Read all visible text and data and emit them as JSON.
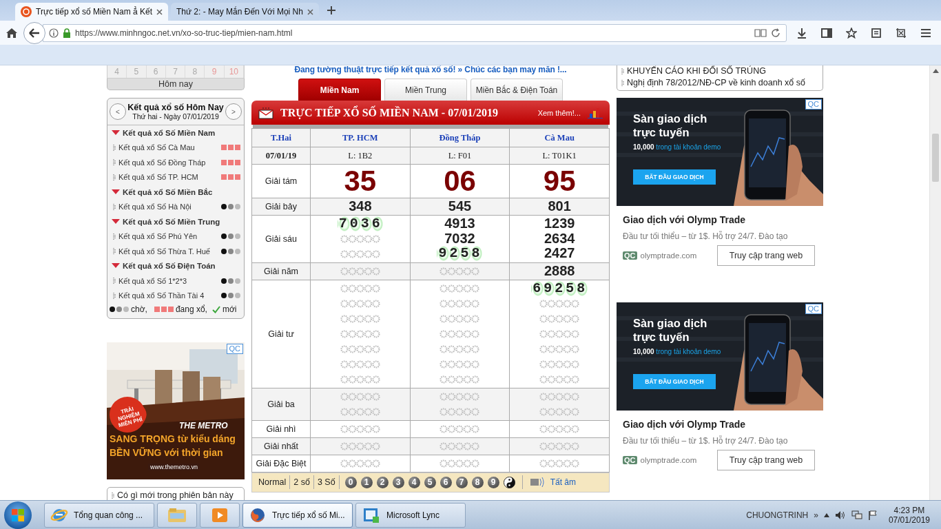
{
  "browser": {
    "tabs": [
      {
        "title": "Trực tiếp xổ số Miền Nam ẳ Kết",
        "selected": true
      },
      {
        "title": "Thứ 2: - May Mắn Đến Với Mọi Nh",
        "selected": false
      }
    ],
    "url": "https://www.minhngoc.net.vn/xo-so-truc-tiep/mien-nam.html"
  },
  "left": {
    "calendar": [
      {
        "day": "4",
        "weekend": false
      },
      {
        "day": "5",
        "weekend": false
      },
      {
        "day": "6",
        "weekend": false
      },
      {
        "day": "7",
        "weekend": false
      },
      {
        "day": "8",
        "weekend": false
      },
      {
        "day": "9",
        "weekend": true
      },
      {
        "day": "10",
        "weekend": true
      }
    ],
    "today_button": "Hôm nay",
    "results_panel": {
      "prev": "<",
      "next": ">",
      "title": "Kết quả xổ số Hôm Nay",
      "subtitle": "Thứ hai - Ngày 07/01/2019",
      "groups": [
        {
          "label": "Kết quả xổ Số Miền Nam",
          "expanded": true,
          "children": [
            {
              "label": "Kết quả xổ Số Cà Mau",
              "drawing": true
            },
            {
              "label": "Kết quả xổ Số Đồng Tháp",
              "drawing": true
            },
            {
              "label": "Kết quả xổ Số TP. HCM",
              "drawing": true
            }
          ]
        },
        {
          "label": "Kết quả xổ Số Miền Bắc",
          "expanded": true,
          "children": [
            {
              "label": "Kết quả xổ Số Hà Nội",
              "drawing": false
            }
          ]
        },
        {
          "label": "Kết quả xổ Số Miền Trung",
          "expanded": true,
          "children": [
            {
              "label": "Kết quả xổ Số Phú Yên",
              "drawing": false
            },
            {
              "label": "Kết quả xổ Số Thừa T. Huế",
              "drawing": false
            }
          ]
        },
        {
          "label": "Kết quả xổ Số Điện Toán",
          "expanded": true,
          "children": [
            {
              "label": "Kết quả xổ Số 1*2*3",
              "drawing": false
            },
            {
              "label": "Kết quả xổ Số Thần Tài 4",
              "drawing": false
            }
          ]
        }
      ],
      "legend": {
        "waiting": "chờ,",
        "drawing": "đang xổ,",
        "new": "mới"
      }
    },
    "ad": {
      "badge": "QC",
      "ribbon": "TRẢI NGHIỆM MIỄN PHÍ",
      "brand": "THE METRO",
      "line_1": "SANG TRỌNG từ kiểu dáng",
      "line_2": "BỀN VỮNG với thời gian",
      "site": "www.themetro.vn"
    },
    "news": [
      "Có gì mới trong phiên bản này"
    ]
  },
  "center": {
    "headline": "Đang tường thuật trực tiếp kết quả xổ số! » Chúc các bạn may mắn !...",
    "tabs": [
      {
        "label": "Miền Nam",
        "selected": true
      },
      {
        "label": "Miền Trung",
        "selected": false
      },
      {
        "label": "Miền Bắc & Điện Toán",
        "selected": false
      }
    ],
    "banner": {
      "title": "TRỰC TIẾP XỔ SỐ MIỀN NAM - 07/01/2019",
      "more": "Xem thêm!..."
    },
    "table": {
      "columns": [
        "T.Hai",
        "TP. HCM",
        "Đồng Tháp",
        "Cà Mau"
      ],
      "date_row": [
        "07/01/19",
        "L: 1B2",
        "L: F01",
        "L: T01K1"
      ],
      "prizes": [
        {
          "label": "Giải tám",
          "cells": [
            [
              {
                "kind": "number",
                "value": "35"
              }
            ],
            [
              {
                "kind": "number",
                "value": "06"
              }
            ],
            [
              {
                "kind": "number",
                "value": "95"
              }
            ]
          ]
        },
        {
          "label": "Giải bảy",
          "cells": [
            [
              {
                "kind": "number",
                "value": "348"
              }
            ],
            [
              {
                "kind": "number",
                "value": "545"
              }
            ],
            [
              {
                "kind": "number",
                "value": "801"
              }
            ]
          ]
        },
        {
          "label": "Giải sáu",
          "cells": [
            [
              {
                "kind": "new",
                "value": "7036"
              },
              {
                "kind": "pending"
              },
              {
                "kind": "pending"
              }
            ],
            [
              {
                "kind": "number",
                "value": "4913"
              },
              {
                "kind": "number",
                "value": "7032"
              },
              {
                "kind": "new",
                "value": "9258"
              }
            ],
            [
              {
                "kind": "number",
                "value": "1239"
              },
              {
                "kind": "number",
                "value": "2634"
              },
              {
                "kind": "number",
                "value": "2427"
              }
            ]
          ]
        },
        {
          "label": "Giải năm",
          "cells": [
            [
              {
                "kind": "pending"
              }
            ],
            [
              {
                "kind": "pending"
              }
            ],
            [
              {
                "kind": "number",
                "value": "2888"
              }
            ]
          ]
        },
        {
          "label": "Giải tư",
          "cells": [
            [
              {
                "kind": "pending"
              },
              {
                "kind": "pending"
              },
              {
                "kind": "pending"
              },
              {
                "kind": "pending"
              },
              {
                "kind": "pending"
              },
              {
                "kind": "pending"
              },
              {
                "kind": "pending"
              }
            ],
            [
              {
                "kind": "pending"
              },
              {
                "kind": "pending"
              },
              {
                "kind": "pending"
              },
              {
                "kind": "pending"
              },
              {
                "kind": "pending"
              },
              {
                "kind": "pending"
              },
              {
                "kind": "pending"
              }
            ],
            [
              {
                "kind": "new",
                "value": "69258"
              },
              {
                "kind": "pending"
              },
              {
                "kind": "pending"
              },
              {
                "kind": "pending"
              },
              {
                "kind": "pending"
              },
              {
                "kind": "pending"
              },
              {
                "kind": "pending"
              }
            ]
          ]
        },
        {
          "label": "Giải ba",
          "cells": [
            [
              {
                "kind": "pending"
              },
              {
                "kind": "pending"
              }
            ],
            [
              {
                "kind": "pending"
              },
              {
                "kind": "pending"
              }
            ],
            [
              {
                "kind": "pending"
              },
              {
                "kind": "pending"
              }
            ]
          ]
        },
        {
          "label": "Giải nhì",
          "cells": [
            [
              {
                "kind": "pending"
              }
            ],
            [
              {
                "kind": "pending"
              }
            ],
            [
              {
                "kind": "pending"
              }
            ]
          ]
        },
        {
          "label": "Giải nhất",
          "cells": [
            [
              {
                "kind": "pending"
              }
            ],
            [
              {
                "kind": "pending"
              }
            ],
            [
              {
                "kind": "pending"
              }
            ]
          ]
        },
        {
          "label": "Giải Đặc Biệt",
          "cells": [
            [
              {
                "kind": "pending"
              }
            ],
            [
              {
                "kind": "pending"
              }
            ],
            [
              {
                "kind": "pending"
              }
            ]
          ]
        }
      ]
    },
    "footer": {
      "modes": [
        "Normal",
        "2 số",
        "3 Số"
      ],
      "digits": [
        "0",
        "1",
        "2",
        "3",
        "4",
        "5",
        "6",
        "7",
        "8",
        "9"
      ],
      "mute": "Tất âm"
    }
  },
  "right": {
    "notices": [
      "KHUYẾN CÁO KHI ĐỔI SỐ TRÚNG",
      "Nghị định 78/2012/NĐ-CP về kinh doanh xổ số"
    ],
    "ads": [
      {
        "badge": "QC",
        "heading": "Sàn giao dịch trực tuyến",
        "offer": "**10,000** trong tài khoản demo",
        "cta": "BẮT ĐẦU GIAO DỊCH",
        "title": "Giao dịch với Olymp Trade",
        "description": "Đầu tư tối thiểu – từ 1$. Hỗ trợ 24/7. Đào tạo",
        "tag": "QC",
        "domain": "olymptrade.com",
        "button": "Truy cập trang web"
      },
      {
        "badge": "QC",
        "heading": "Sàn giao dịch trực tuyến",
        "offer": "**10,000** trong tài khoản demo",
        "cta": "BẮT ĐẦU GIAO DỊCH",
        "title": "Giao dịch với Olymp Trade",
        "description": "Đầu tư tối thiểu – từ 1$. Hỗ trợ 24/7. Đào tạo",
        "tag": "QC",
        "domain": "olymptrade.com",
        "button": "Truy cập trang web"
      }
    ]
  },
  "taskbar": {
    "items": [
      {
        "label": "Tổng quan công ...",
        "selected": false
      },
      {
        "selected": false
      },
      {
        "selected": false
      },
      {
        "label": "Trực tiếp xổ số Mi...",
        "selected": true
      },
      {
        "label": "Microsoft Lync",
        "selected": false
      }
    ],
    "tray_label": "CHUONGTRINH",
    "overflow": "»",
    "time": "4:23 PM",
    "date": "07/01/2019"
  }
}
